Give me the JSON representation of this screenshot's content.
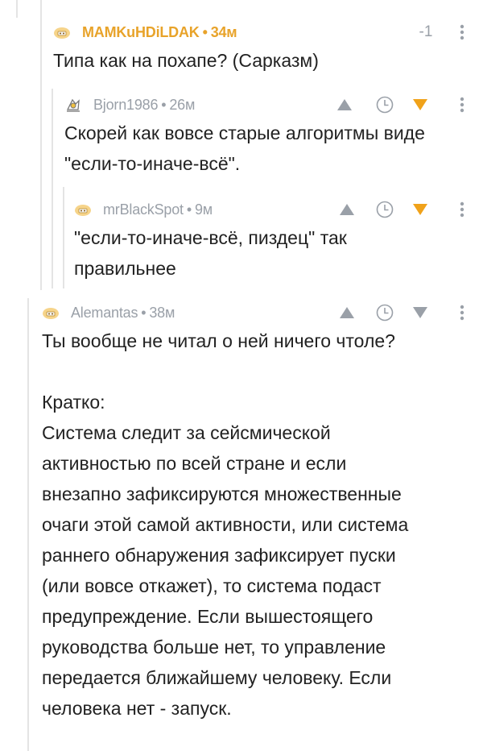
{
  "comments": [
    {
      "author": "MAMKuHDiLDAK",
      "time": "34м",
      "score": "-1",
      "text": "Типа как на похапе? (Сарказм)"
    },
    {
      "author": "Bjorn1986",
      "time": "26м",
      "text": "Скорей как вовсе старые алгоритмы виде\n\"если-то-иначе-всё\"."
    },
    {
      "author": "mrBlackSpot",
      "time": "9м",
      "text": "\"если-то-иначе-всё, пиздец\" так\nправильнее"
    },
    {
      "author": "Alemantas",
      "time": "38м",
      "text": "Ты вообще не читал о ней ничего чтоле?\n\nКратко:\nСистема следит за сейсмической\nактивностью по всей стране и если\nвнезапно зафиксируются множественные\nочаги этой самой активности, или система\nраннего обнаружения зафиксирует пуски\n(или вовсе откажет), то система подаст\nпредупреждение. Если вышестоящего\nруководства больше нет, то управление\nпередается ближайшему человеку. Если\nчеловека нет - запуск."
    }
  ],
  "separator": "•",
  "colors": {
    "accent": "#e8a32a",
    "vote_down_active": "#f0a21a",
    "muted": "#9aa0a8",
    "thread_line": "#e4e4e4"
  },
  "icons": [
    "avatar-icon",
    "upvote-icon",
    "save-clock-icon",
    "downvote-icon",
    "more-icon"
  ]
}
